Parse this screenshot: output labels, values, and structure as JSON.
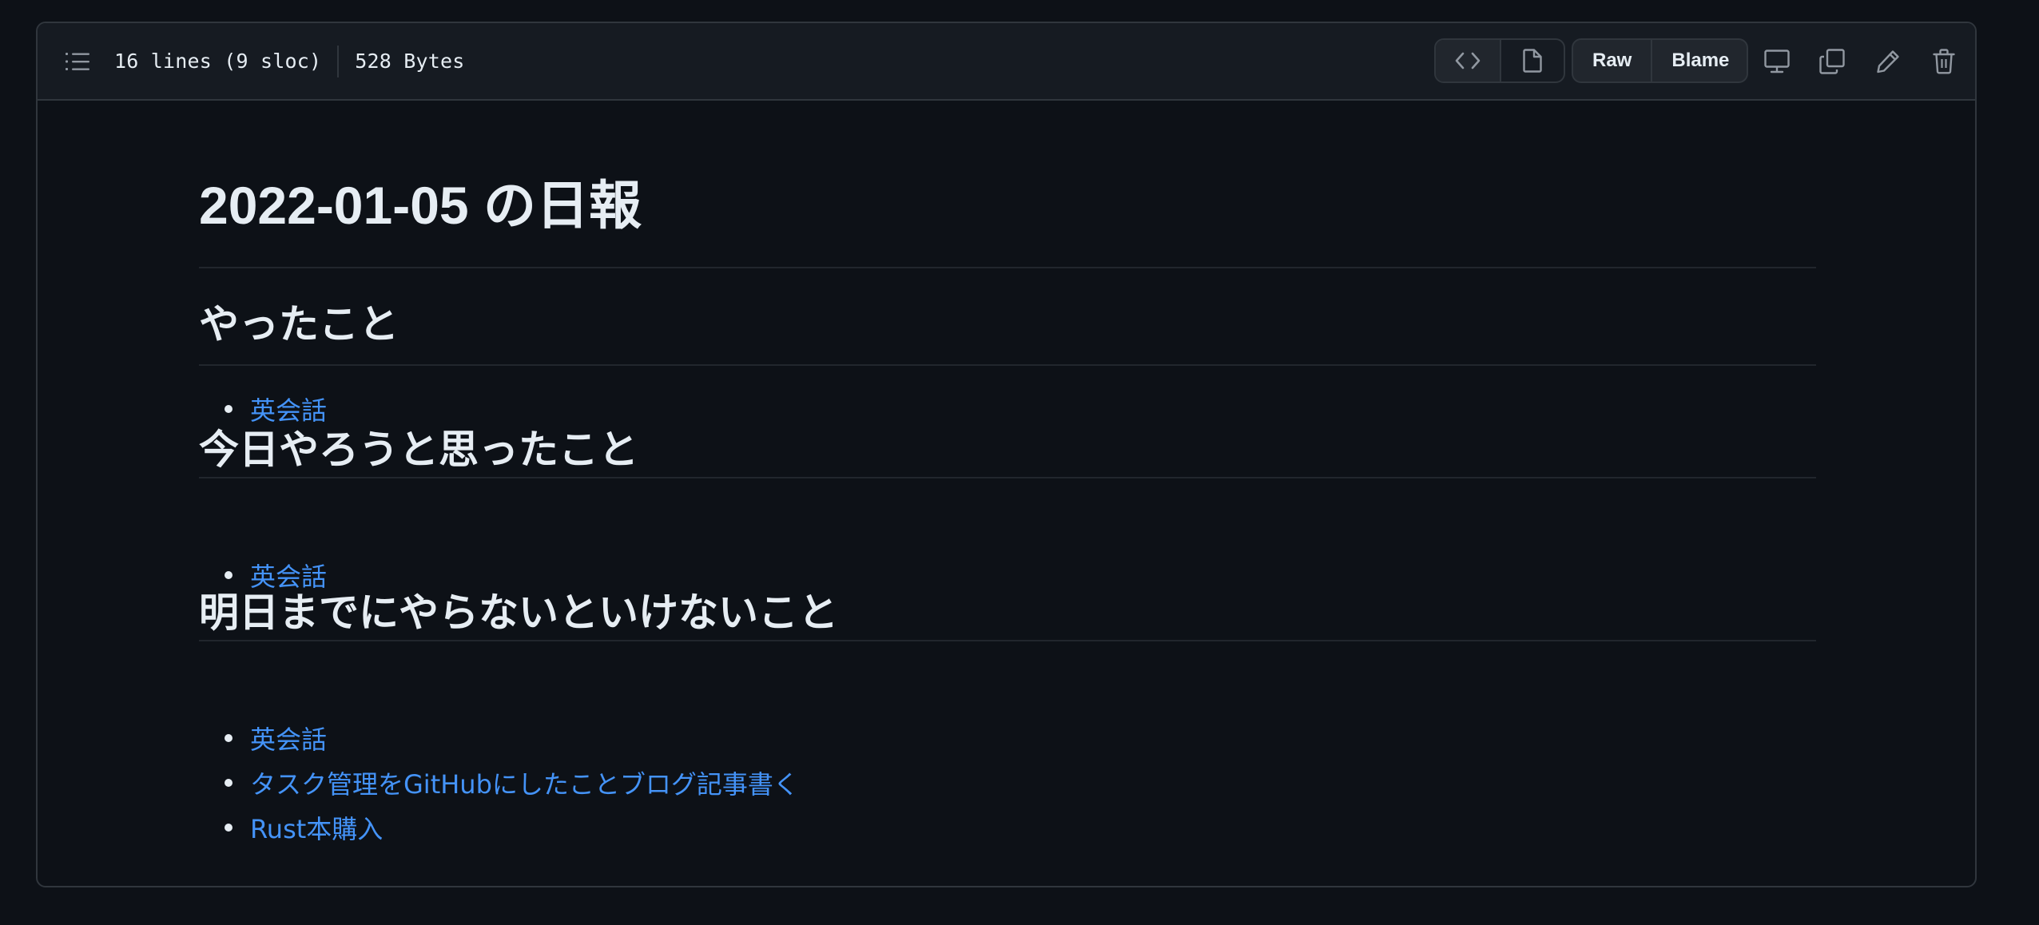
{
  "header": {
    "lines_info": "16 lines (9 sloc)",
    "size_info": "528 Bytes",
    "raw_label": "Raw",
    "blame_label": "Blame"
  },
  "icons": {
    "toc": "list-unordered-icon",
    "code_view": "code-icon",
    "preview": "file-icon",
    "desktop": "device-desktop-icon",
    "copy": "copy-icon",
    "edit": "pencil-icon",
    "delete": "trash-icon"
  },
  "document": {
    "title": "2022-01-05 の日報",
    "sections": [
      {
        "heading": "やったこと",
        "items": [
          "英会話"
        ]
      },
      {
        "heading": "今日やろうと思ったこと",
        "items": [
          "英会話"
        ]
      },
      {
        "heading": "明日までにやらないといけないこと",
        "items": [
          "英会話",
          "タスク管理をGitHubにしたことブログ記事書く",
          "Rust本購入"
        ]
      }
    ]
  },
  "colors": {
    "background": "#0d1117",
    "header_bg": "#161b22",
    "border": "#30363d",
    "text": "#e6edf3",
    "link": "#4493f8"
  }
}
